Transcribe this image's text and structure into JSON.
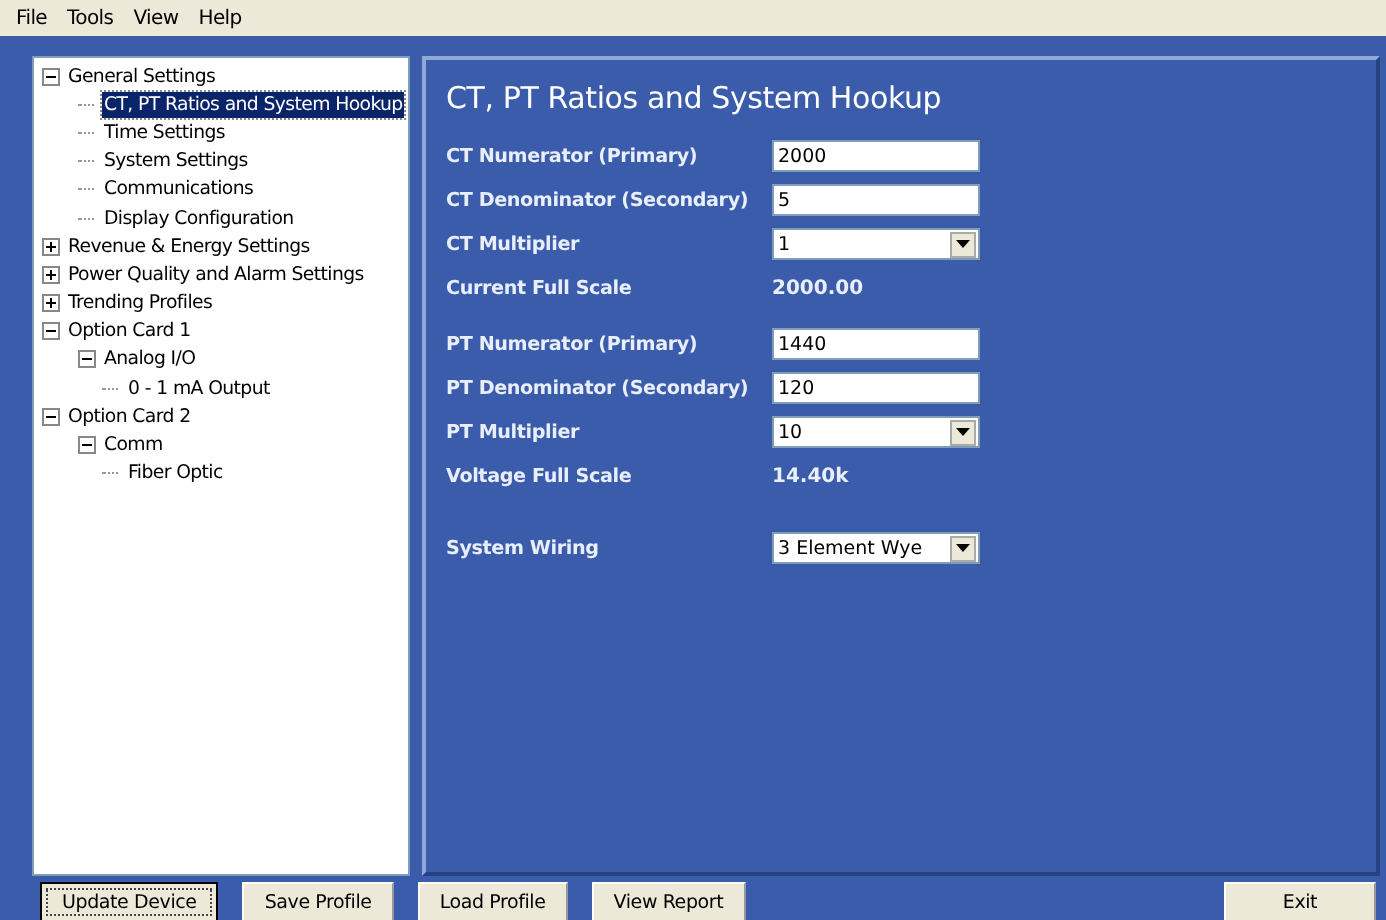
{
  "menu": [
    "File",
    "Tools",
    "View",
    "Help"
  ],
  "tree": [
    {
      "label": "General Settings",
      "expanded": true,
      "selected": false,
      "children": [
        {
          "label": "CT, PT Ratios and System Hookup",
          "selected": true
        },
        {
          "label": "Time Settings",
          "selected": false
        },
        {
          "label": "System Settings",
          "selected": false
        },
        {
          "label": "Communications",
          "selected": false
        },
        {
          "label": "Display Configuration",
          "selected": false
        }
      ]
    },
    {
      "label": "Revenue & Energy Settings",
      "expanded": false,
      "selected": false
    },
    {
      "label": "Power Quality and Alarm Settings",
      "expanded": false,
      "selected": false
    },
    {
      "label": "Trending Profiles",
      "expanded": false,
      "selected": false
    },
    {
      "label": "Option Card 1",
      "expanded": true,
      "selected": false,
      "children": [
        {
          "label": "Analog I/O",
          "expanded": true,
          "selected": false,
          "children": [
            {
              "label": "0 - 1 mA Output",
              "selected": false
            }
          ]
        }
      ]
    },
    {
      "label": "Option Card 2",
      "expanded": true,
      "selected": false,
      "children": [
        {
          "label": "Comm",
          "expanded": true,
          "selected": false,
          "children": [
            {
              "label": "Fiber Optic",
              "selected": false
            }
          ]
        }
      ]
    }
  ],
  "panel": {
    "title": "CT, PT Ratios and System Hookup",
    "groups": [
      [
        {
          "kind": "text",
          "label": "CT Numerator (Primary)",
          "value": "2000"
        },
        {
          "kind": "text",
          "label": "CT Denominator (Secondary)",
          "value": "5"
        },
        {
          "kind": "select",
          "label": "CT Multiplier",
          "value": "1"
        },
        {
          "kind": "readout",
          "label": "Current Full Scale",
          "value": "2000.00"
        }
      ],
      [
        {
          "kind": "text",
          "label": "PT Numerator (Primary)",
          "value": "1440"
        },
        {
          "kind": "text",
          "label": "PT Denominator (Secondary)",
          "value": "120"
        },
        {
          "kind": "select",
          "label": "PT Multiplier",
          "value": "10"
        },
        {
          "kind": "readout",
          "label": "Voltage Full Scale",
          "value": "14.40k"
        }
      ],
      [
        {
          "kind": "select",
          "label": "System Wiring",
          "value": "3 Element Wye"
        }
      ]
    ]
  },
  "buttons": [
    {
      "label": "Update Device",
      "focused": true
    },
    {
      "label": "Save Profile",
      "focused": false
    },
    {
      "label": "Load Profile",
      "focused": false
    },
    {
      "label": "View Report",
      "focused": false
    },
    {
      "label": "Exit",
      "focused": false,
      "kind": "right"
    }
  ]
}
